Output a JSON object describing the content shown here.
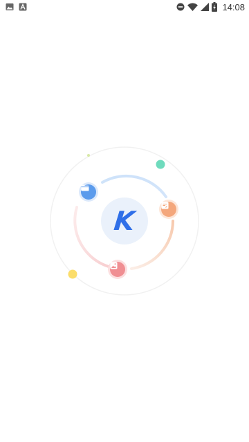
{
  "status_bar": {
    "time": "14:08",
    "left_icons": [
      "image-notification-icon",
      "font-notification-icon"
    ],
    "right_icons": [
      "do-not-disturb-icon",
      "wifi-icon",
      "cellular-signal-icon",
      "battery-charging-icon"
    ]
  },
  "splash": {
    "logo_letter": "K",
    "colors": {
      "logo_blue": "#2f6fe8",
      "logo_bg": "#eaf1fb",
      "folder_node": "#5b9bec",
      "doc_node": "#f4a77c",
      "image_node": "#f08f93",
      "green_dot": "#6fdbbd",
      "yellow_dot": "#fbdd6a"
    },
    "nodes": [
      {
        "name": "folder-icon"
      },
      {
        "name": "document-icon"
      },
      {
        "name": "image-icon"
      }
    ]
  }
}
